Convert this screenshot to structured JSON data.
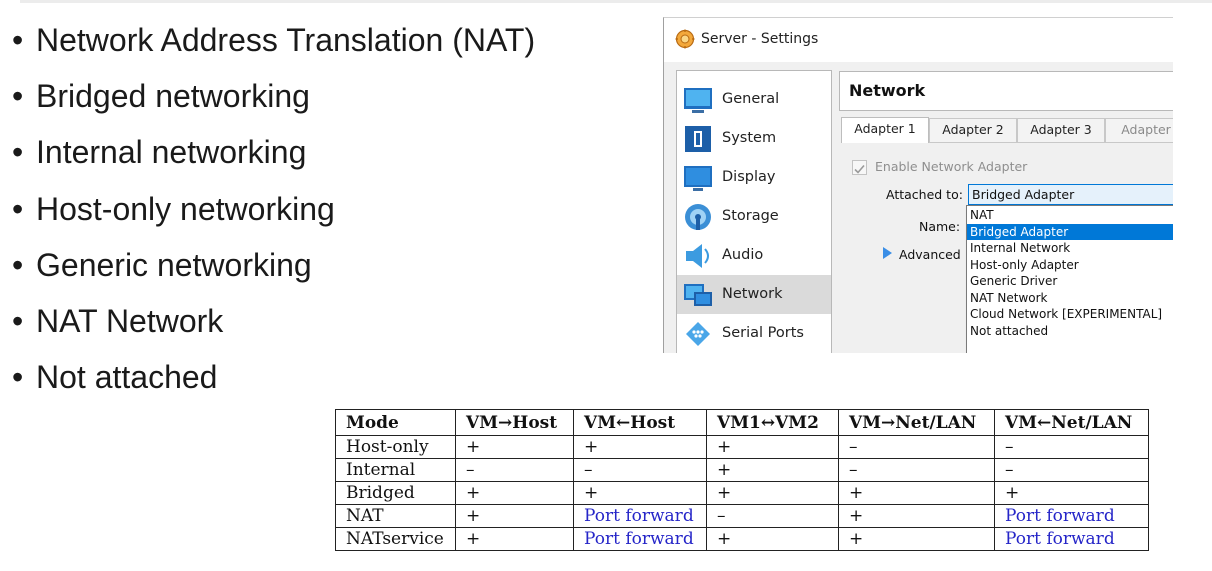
{
  "bullets": [
    "Network Address Translation (NAT)",
    "Bridged networking",
    "Internal networking",
    "Host-only networking",
    "Generic networking",
    "NAT Network",
    "Not attached"
  ],
  "bullet_glyph": "•",
  "window": {
    "title": "Server - Settings",
    "sidebar": [
      {
        "label": "General",
        "icon": "general-icon"
      },
      {
        "label": "System",
        "icon": "system-icon"
      },
      {
        "label": "Display",
        "icon": "display-icon"
      },
      {
        "label": "Storage",
        "icon": "storage-icon"
      },
      {
        "label": "Audio",
        "icon": "audio-icon"
      },
      {
        "label": "Network",
        "icon": "network-icon",
        "selected": true
      },
      {
        "label": "Serial Ports",
        "icon": "serial-ports-icon"
      }
    ],
    "panel_title": "Network",
    "tabs": [
      "Adapter 1",
      "Adapter 2",
      "Adapter 3",
      "Adapter"
    ],
    "enable_label": "Enable Network Adapter",
    "enable_checked": true,
    "attached_label": "Attached to:",
    "attached_value": "Bridged Adapter",
    "name_label": "Name:",
    "advanced_label": "Advanced",
    "dropdown_options": [
      "NAT",
      "Bridged Adapter",
      "Internal Network",
      "Host-only Adapter",
      "Generic Driver",
      "NAT Network",
      "Cloud Network [EXPERIMENTAL]",
      "Not attached"
    ],
    "dropdown_selected": "Bridged Adapter",
    "accent_color": "#0078d7"
  },
  "table": {
    "headers": [
      "Mode",
      "VM→Host",
      "VM←Host",
      "VM1↔VM2",
      "VM→Net/LAN",
      "VM←Net/LAN"
    ],
    "rows": [
      [
        "Host-only",
        "+",
        "+",
        "+",
        "–",
        "–"
      ],
      [
        "Internal",
        "–",
        "–",
        "+",
        "–",
        "–"
      ],
      [
        "Bridged",
        "+",
        "+",
        "+",
        "+",
        "+"
      ],
      [
        "NAT",
        "+",
        "Port forward",
        "–",
        "+",
        "Port forward"
      ],
      [
        "NATservice",
        "+",
        "Port forward",
        "+",
        "+",
        "Port forward"
      ]
    ],
    "link_color": "#2525c8"
  }
}
